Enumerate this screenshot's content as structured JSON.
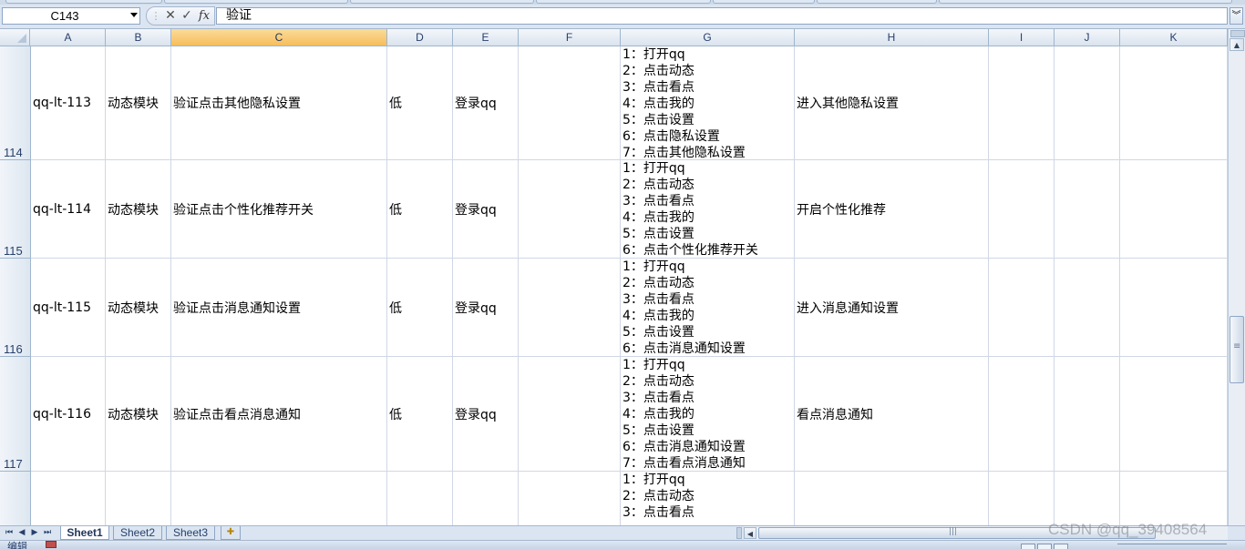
{
  "formula_bar": {
    "name_box": "C143",
    "formula_value": "验证",
    "cancel_glyph": "✕",
    "enter_glyph": "✓",
    "fx_label": "fx"
  },
  "columns": [
    "A",
    "B",
    "C",
    "D",
    "E",
    "F",
    "G",
    "H",
    "I",
    "J",
    "K"
  ],
  "active_column": "C",
  "rows": [
    {
      "row_number": "114",
      "id": "qq-lt-113",
      "module": "动态模块",
      "title": "验证点击其他隐私设置",
      "priority": "低",
      "precondition": "登录qq",
      "steps": [
        "1：打开qq",
        "2：点击动态",
        "3：点击看点",
        "4：点击我的",
        "5：点击设置",
        "6：点击隐私设置",
        "7：点击其他隐私设置"
      ],
      "expected": "进入其他隐私设置"
    },
    {
      "row_number": "115",
      "id": "qq-lt-114",
      "module": "动态模块",
      "title": "验证点击个性化推荐开关",
      "priority": "低",
      "precondition": "登录qq",
      "steps": [
        "1：打开qq",
        "2：点击动态",
        "3：点击看点",
        "4：点击我的",
        "5：点击设置",
        "6：点击个性化推荐开关"
      ],
      "expected": "开启个性化推荐"
    },
    {
      "row_number": "116",
      "id": "qq-lt-115",
      "module": "动态模块",
      "title": "验证点击消息通知设置",
      "priority": "低",
      "precondition": "登录qq",
      "steps": [
        "1：打开qq",
        "2：点击动态",
        "3：点击看点",
        "4：点击我的",
        "5：点击设置",
        "6：点击消息通知设置"
      ],
      "expected": "进入消息通知设置"
    },
    {
      "row_number": "117",
      "id": "qq-lt-116",
      "module": "动态模块",
      "title": "验证点击看点消息通知",
      "priority": "低",
      "precondition": "登录qq",
      "steps": [
        "1：打开qq",
        "2：点击动态",
        "3：点击看点",
        "4：点击我的",
        "5：点击设置",
        "6：点击消息通知设置",
        "7：点击看点消息通知"
      ],
      "expected": "看点消息通知"
    },
    {
      "row_number": "",
      "id": "",
      "module": "",
      "title": "",
      "priority": "",
      "precondition": "",
      "steps": [
        "1：打开qq",
        "2：点击动态",
        "3：点击看点"
      ],
      "expected": ""
    }
  ],
  "sheet_tabs": [
    "Sheet1",
    "Sheet2",
    "Sheet3"
  ],
  "active_sheet": "Sheet1",
  "tab_nav": [
    "⏮",
    "◀",
    "▶",
    "⏭"
  ],
  "status": {
    "mode": "编辑"
  },
  "watermark": "CSDN @qq_39408564"
}
